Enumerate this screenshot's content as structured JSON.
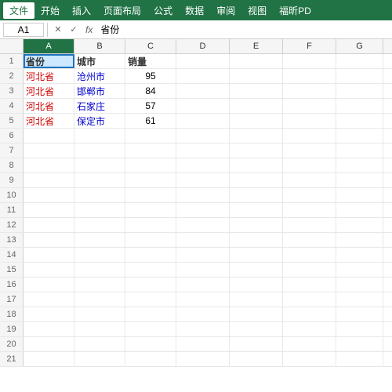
{
  "menuBar": {
    "items": [
      "文件",
      "开始",
      "插入",
      "页面布局",
      "公式",
      "数据",
      "审阅",
      "视图",
      "福昕PD"
    ]
  },
  "formulaBar": {
    "cellRef": "A1",
    "formula": "省份",
    "fxLabel": "fx"
  },
  "columns": [
    "A",
    "B",
    "C",
    "D",
    "E",
    "F",
    "G"
  ],
  "rows": [
    {
      "num": "1",
      "a": "省份",
      "b": "城市",
      "c": "销量",
      "d": "",
      "e": "",
      "f": "",
      "g": ""
    },
    {
      "num": "2",
      "a": "河北省",
      "b": "沧州市",
      "c": "95",
      "d": "",
      "e": "",
      "f": "",
      "g": ""
    },
    {
      "num": "3",
      "a": "河北省",
      "b": "邯郸市",
      "c": "84",
      "d": "",
      "e": "",
      "f": "",
      "g": ""
    },
    {
      "num": "4",
      "a": "河北省",
      "b": "石家庄",
      "c": "57",
      "d": "",
      "e": "",
      "f": "",
      "g": ""
    },
    {
      "num": "5",
      "a": "河北省",
      "b": "保定市",
      "c": "61",
      "d": "",
      "e": "",
      "f": "",
      "g": ""
    },
    {
      "num": "6",
      "a": "",
      "b": "",
      "c": "",
      "d": "",
      "e": "",
      "f": "",
      "g": ""
    },
    {
      "num": "7",
      "a": "",
      "b": "",
      "c": "",
      "d": "",
      "e": "",
      "f": "",
      "g": ""
    },
    {
      "num": "8",
      "a": "",
      "b": "",
      "c": "",
      "d": "",
      "e": "",
      "f": "",
      "g": ""
    },
    {
      "num": "9",
      "a": "",
      "b": "",
      "c": "",
      "d": "",
      "e": "",
      "f": "",
      "g": ""
    },
    {
      "num": "10",
      "a": "",
      "b": "",
      "c": "",
      "d": "",
      "e": "",
      "f": "",
      "g": ""
    },
    {
      "num": "11",
      "a": "",
      "b": "",
      "c": "",
      "d": "",
      "e": "",
      "f": "",
      "g": ""
    },
    {
      "num": "12",
      "a": "",
      "b": "",
      "c": "",
      "d": "",
      "e": "",
      "f": "",
      "g": ""
    },
    {
      "num": "13",
      "a": "",
      "b": "",
      "c": "",
      "d": "",
      "e": "",
      "f": "",
      "g": ""
    },
    {
      "num": "14",
      "a": "",
      "b": "",
      "c": "",
      "d": "",
      "e": "",
      "f": "",
      "g": ""
    },
    {
      "num": "15",
      "a": "",
      "b": "",
      "c": "",
      "d": "",
      "e": "",
      "f": "",
      "g": ""
    },
    {
      "num": "16",
      "a": "",
      "b": "",
      "c": "",
      "d": "",
      "e": "",
      "f": "",
      "g": ""
    },
    {
      "num": "17",
      "a": "",
      "b": "",
      "c": "",
      "d": "",
      "e": "",
      "f": "",
      "g": ""
    },
    {
      "num": "18",
      "a": "",
      "b": "",
      "c": "",
      "d": "",
      "e": "",
      "f": "",
      "g": ""
    },
    {
      "num": "19",
      "a": "",
      "b": "",
      "c": "",
      "d": "",
      "e": "",
      "f": "",
      "g": ""
    },
    {
      "num": "20",
      "a": "",
      "b": "",
      "c": "",
      "d": "",
      "e": "",
      "f": "",
      "g": ""
    },
    {
      "num": "21",
      "a": "",
      "b": "",
      "c": "",
      "d": "",
      "e": "",
      "f": "",
      "g": ""
    }
  ]
}
